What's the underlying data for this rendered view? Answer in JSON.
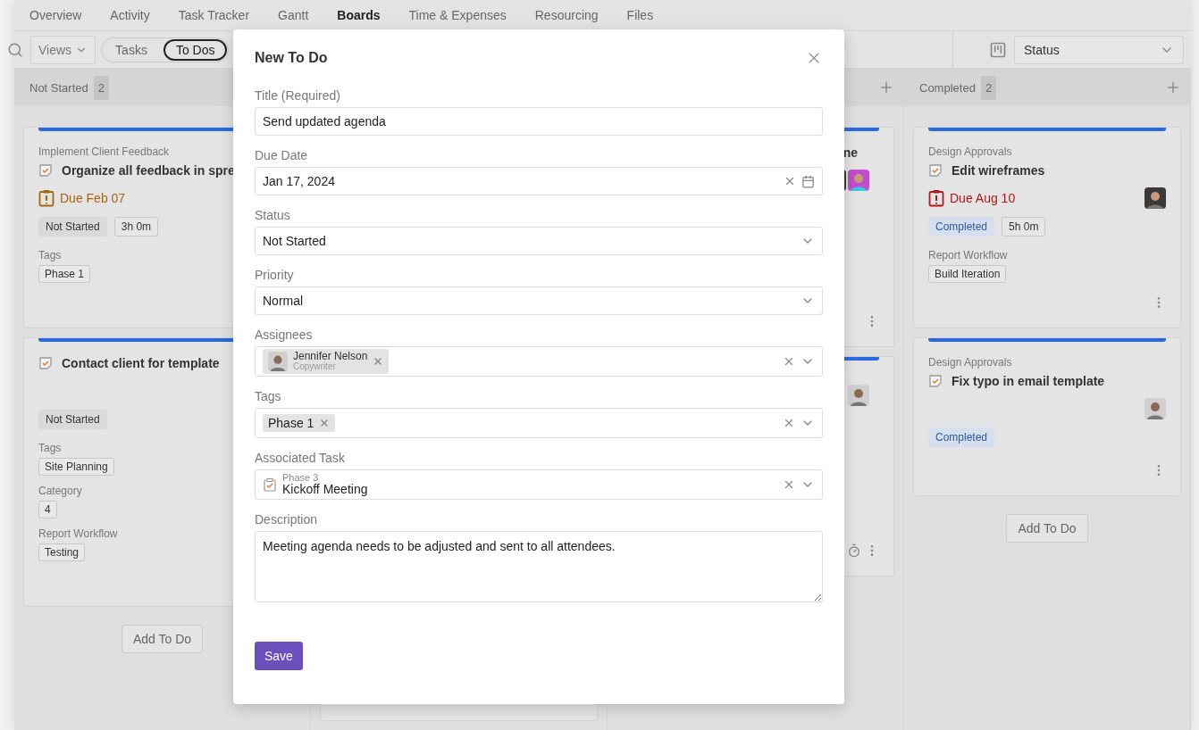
{
  "nav": {
    "tabs": [
      {
        "label": "Overview",
        "selected": false
      },
      {
        "label": "Activity",
        "selected": false
      },
      {
        "label": "Task Tracker",
        "selected": false
      },
      {
        "label": "Gantt",
        "selected": false
      },
      {
        "label": "Boards",
        "selected": true
      },
      {
        "label": "Time & Expenses",
        "selected": false
      },
      {
        "label": "Resourcing",
        "selected": false
      },
      {
        "label": "Files",
        "selected": false
      }
    ]
  },
  "toolbar": {
    "views": "Views",
    "toggle": [
      {
        "label": "Tasks",
        "selected": false
      },
      {
        "label": "To Dos",
        "selected": true
      }
    ],
    "group_by": "Status"
  },
  "columns": [
    {
      "kind": "open",
      "name": "Not Started",
      "count": "2",
      "add_button": "Add To Do",
      "cards": [
        {
          "category": "Implement Client Feedback",
          "title": "Organize all feedback in spre",
          "due": {
            "text": "Due Feb 07",
            "overdue": false
          },
          "status": {
            "text": "Not Started",
            "kind": "neutral"
          },
          "duration": "3h 0m",
          "sections": [
            {
              "label": "Tags",
              "value": "Phase 1"
            }
          ]
        },
        {
          "title": "Contact client for template",
          "status": {
            "text": "Not Started",
            "kind": "neutral"
          },
          "sections": [
            {
              "label": "Tags",
              "value": "Site Planning"
            },
            {
              "label": "Category",
              "value": "4"
            },
            {
              "label": "Report Workflow",
              "value": "Testing"
            }
          ]
        }
      ]
    },
    {
      "kind": "covered"
    },
    {
      "kind": "partial",
      "add": true,
      "cards": [
        {
          "title": "ne",
          "avatars": [
            {
              "kind": "dark"
            },
            {
              "kind": "colorful"
            }
          ],
          "menu": true
        },
        {
          "avatars": [
            {
              "kind": "light"
            }
          ],
          "timer": true,
          "menu": true
        }
      ]
    },
    {
      "kind": "open",
      "name": "Completed",
      "count": "2",
      "add": true,
      "add_button": "Add To Do",
      "cards": [
        {
          "category": "Design Approvals",
          "title": "Edit wireframes",
          "due": {
            "text": "Due Aug 10",
            "overdue": true
          },
          "avatars": [
            {
              "kind": "dark"
            }
          ],
          "status": {
            "text": "Completed",
            "kind": "done"
          },
          "duration": "5h 0m",
          "sections": [
            {
              "label": "Report Workflow",
              "value": "Build Iteration"
            }
          ],
          "menu": true
        },
        {
          "category": "Design Approvals",
          "title": "Fix typo in email template",
          "avatars": [
            {
              "kind": "light"
            }
          ],
          "status": {
            "text": "Completed",
            "kind": "done"
          },
          "menu": true
        }
      ]
    }
  ],
  "modal": {
    "title": "New To Do",
    "fields": [
      {
        "kind": "text",
        "label": "Title (Required)",
        "value": "Send updated agenda"
      },
      {
        "kind": "date",
        "label": "Due Date",
        "value": "Jan 17, 2024"
      },
      {
        "kind": "select",
        "label": "Status",
        "value": "Not Started"
      },
      {
        "kind": "select",
        "label": "Priority",
        "value": "Normal"
      },
      {
        "kind": "people",
        "label": "Assignees",
        "chips": [
          {
            "name": "Jennifer Nelson",
            "role": "Copywriter"
          }
        ]
      },
      {
        "kind": "chips",
        "label": "Tags",
        "chips": [
          {
            "name": "Phase 1"
          }
        ]
      },
      {
        "kind": "task",
        "label": "Associated Task",
        "group": "Phase 3",
        "value": "Kickoff Meeting"
      },
      {
        "kind": "textarea",
        "label": "Description",
        "value": "Meeting agenda needs to be adjusted and sent to all attendees."
      }
    ],
    "save": "Save"
  }
}
